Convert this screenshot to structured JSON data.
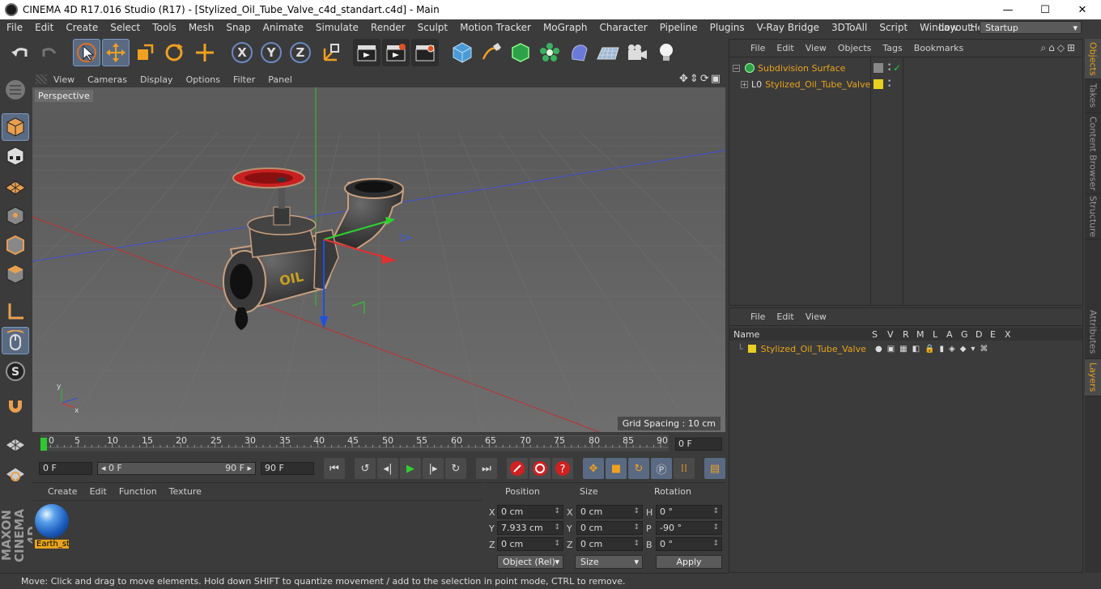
{
  "window": {
    "title": "CINEMA 4D R17.016 Studio (R17) - [Stylized_Oil_Tube_Valve_c4d_standart.c4d] - Main",
    "minimize": "—",
    "maximize": "☐",
    "close": "✕"
  },
  "menu": [
    "File",
    "Edit",
    "Create",
    "Select",
    "Tools",
    "Mesh",
    "Snap",
    "Animate",
    "Simulate",
    "Render",
    "Sculpt",
    "Motion Tracker",
    "MoGraph",
    "Character",
    "Pipeline",
    "Plugins",
    "V-Ray Bridge",
    "3DToAll",
    "Script",
    "Window",
    "Help"
  ],
  "layout": {
    "label": "Layout:",
    "value": "Startup"
  },
  "toolbar": {
    "x_label": "X",
    "y_label": "Y",
    "z_label": "Z"
  },
  "viewport": {
    "menu": [
      "View",
      "Cameras",
      "Display",
      "Options",
      "Filter",
      "Panel"
    ],
    "camera": "Perspective",
    "grid_spacing": "Grid Spacing : 10 cm",
    "object_label": "OIL",
    "axis_y": "y",
    "axis_x": "x"
  },
  "timeline": {
    "ticks": [
      "0",
      "5",
      "10",
      "15",
      "20",
      "25",
      "30",
      "35",
      "40",
      "45",
      "50",
      "55",
      "60",
      "65",
      "70",
      "75",
      "80",
      "85",
      "90"
    ],
    "current": "0 F"
  },
  "transport": {
    "start": "0 F",
    "range_start": "◂ 0 F",
    "range_end": "90 F ▸",
    "end": "90 F"
  },
  "materials": {
    "menu": [
      "Create",
      "Edit",
      "Function",
      "Texture"
    ],
    "items": [
      {
        "name": "Earth_st"
      }
    ]
  },
  "coordinates": {
    "headers": {
      "position": "Position",
      "size": "Size",
      "rotation": "Rotation"
    },
    "rows": [
      {
        "axis": "X",
        "pos": "0 cm",
        "size_axis": "X",
        "size": "0 cm",
        "rot_axis": "H",
        "rot": "0 °"
      },
      {
        "axis": "Y",
        "pos": "7.933 cm",
        "size_axis": "Y",
        "size": "0 cm",
        "rot_axis": "P",
        "rot": "-90 °"
      },
      {
        "axis": "Z",
        "pos": "0 cm",
        "size_axis": "Z",
        "size": "0 cm",
        "rot_axis": "B",
        "rot": "0 °"
      }
    ],
    "mode": "Object (Rel)",
    "size_mode": "Size",
    "apply": "Apply"
  },
  "status": "Move: Click and drag to move elements. Hold down SHIFT to quantize movement / add to the selection in point mode, CTRL to remove.",
  "object_manager": {
    "menu": [
      "File",
      "Edit",
      "View",
      "Objects",
      "Tags",
      "Bookmarks"
    ],
    "objects": [
      {
        "name": "Subdivision Surface"
      },
      {
        "name": "Stylized_Oil_Tube_Valve"
      }
    ]
  },
  "attribute_manager": {
    "menu": [
      "File",
      "Edit",
      "View"
    ],
    "columns": [
      "Name",
      "S",
      "V",
      "R",
      "M",
      "L",
      "A",
      "G",
      "D",
      "E",
      "X"
    ],
    "layers": [
      {
        "name": "Stylized_Oil_Tube_Valve"
      }
    ]
  },
  "right_tabs": [
    "Objects",
    "Takes",
    "Content Browser",
    "Structure",
    "Attributes",
    "Layers"
  ],
  "branding": "MAXON CINEMA 4D",
  "colors": {
    "accent": "#e8a419",
    "x_axis": "#e03030",
    "y_axis": "#30c030",
    "z_axis": "#3050e0"
  }
}
